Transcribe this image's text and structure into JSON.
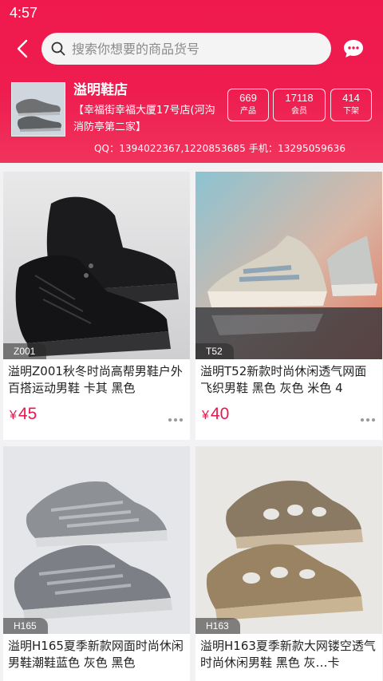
{
  "status": {
    "time": "4:57"
  },
  "header": {
    "search_placeholder": "搜索你想要的商品货号",
    "accent_color": "#ee1c4f"
  },
  "shop": {
    "name": "溢明鞋店",
    "address": "【幸福街幸福大厦17号店(河沟消防亭第二家】",
    "stats": [
      {
        "value": "669",
        "label": "产品"
      },
      {
        "value": "17118",
        "label": "会员"
      },
      {
        "value": "414",
        "label": "下架"
      }
    ],
    "contact": "QQ：1394022367,1220853685 手机：13295059636"
  },
  "products": [
    {
      "sku": "Z001",
      "title": "溢明Z001秋冬时尚高帮男鞋户外百搭运动男鞋 卡其 黑色",
      "currency": "¥",
      "price": "45"
    },
    {
      "sku": "T52",
      "title": "溢明T52新款时尚休闲透气网面飞织男鞋 黑色 灰色 米色 4",
      "currency": "¥",
      "price": "40"
    },
    {
      "sku": "H165",
      "title": "溢明H165夏季新款网面时尚休闲男鞋潮鞋蓝色 灰色 黑色",
      "currency": "¥",
      "price": ""
    },
    {
      "sku": "H163",
      "title": "溢明H163夏季新款大网镂空透气时尚休闲男鞋 黑色 灰…卡",
      "currency": "¥",
      "price": ""
    }
  ]
}
